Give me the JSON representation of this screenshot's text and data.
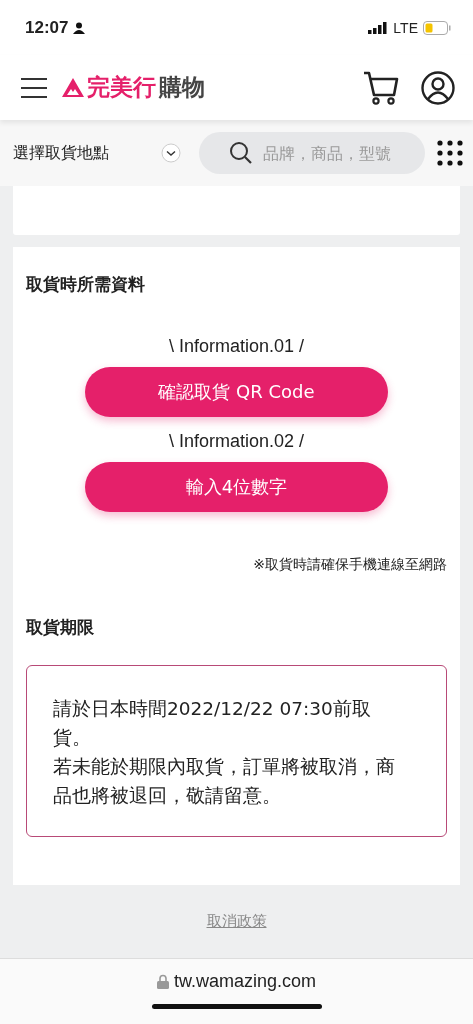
{
  "status_bar": {
    "time": "12:07",
    "network": "LTE"
  },
  "header": {
    "logo_brand": "完美行",
    "logo_suffix": "購物"
  },
  "toolbar": {
    "pickup_select": "選擇取貨地點",
    "search": {
      "placeholder": "品牌，商品，型號"
    }
  },
  "pickup_info": {
    "title": "取貨時所需資料",
    "options": [
      {
        "caption": "\\ Information.01 /",
        "button": "確認取貨 QR Code"
      },
      {
        "caption": "\\ Information.02 /",
        "button": "輸入4位數字"
      }
    ],
    "note": "※取貨時請確保手機連線至網路"
  },
  "deadline": {
    "title": "取貨期限",
    "paragraphs": [
      "請於日本時間2022/12/22 07:30前取貨。",
      "若未能於期限內取貨，訂單將被取消，商品也將被退回，敬請留意。"
    ]
  },
  "footer": {
    "link": "取消政策"
  },
  "browser_bar": {
    "url": "tw.wamazing.com"
  }
}
